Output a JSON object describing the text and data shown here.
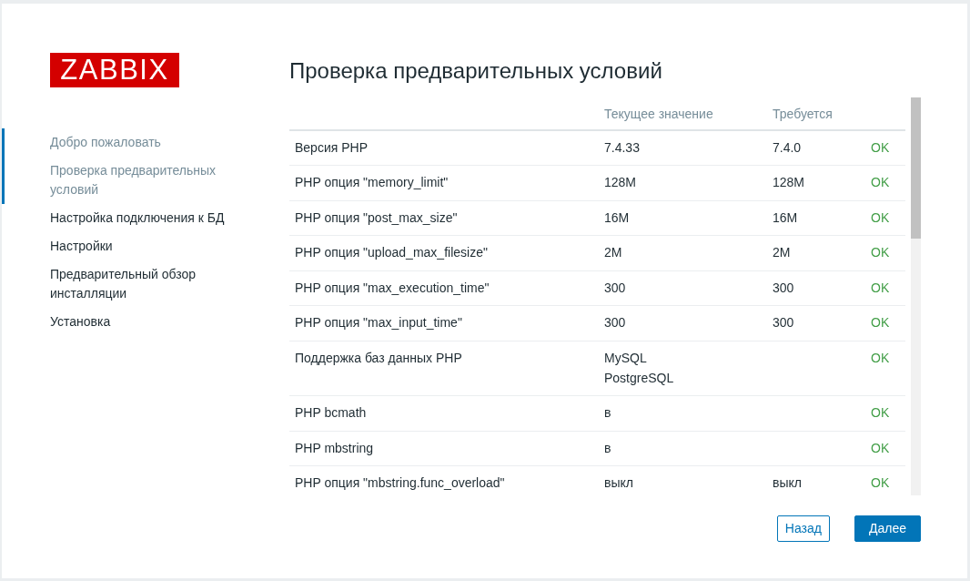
{
  "logo": {
    "text": "ZABBIX"
  },
  "steps": [
    {
      "label": "Добро пожаловать",
      "active": true
    },
    {
      "label": "Проверка предварительных условий",
      "active": true
    },
    {
      "label": "Настройка подключения к БД",
      "active": false
    },
    {
      "label": "Настройки",
      "active": false
    },
    {
      "label": "Предварительный обзор инсталляции",
      "active": false
    },
    {
      "label": "Установка",
      "active": false
    }
  ],
  "title": "Проверка предварительных условий",
  "table": {
    "columns": [
      {
        "label": "Текущее значение"
      },
      {
        "label": "Требуется"
      }
    ],
    "rows": [
      {
        "name": "Версия PHP",
        "current": [
          "7.4.33"
        ],
        "required": "7.4.0",
        "result": "OK",
        "passed": true
      },
      {
        "name": "PHP опция \"memory_limit\"",
        "current": [
          "128M"
        ],
        "required": "128M",
        "result": "OK",
        "passed": true
      },
      {
        "name": "PHP опция \"post_max_size\"",
        "current": [
          "16M"
        ],
        "required": "16M",
        "result": "OK",
        "passed": true
      },
      {
        "name": "PHP опция \"upload_max_filesize\"",
        "current": [
          "2M"
        ],
        "required": "2M",
        "result": "OK",
        "passed": true
      },
      {
        "name": "PHP опция \"max_execution_time\"",
        "current": [
          "300"
        ],
        "required": "300",
        "result": "OK",
        "passed": true
      },
      {
        "name": "PHP опция \"max_input_time\"",
        "current": [
          "300"
        ],
        "required": "300",
        "result": "OK",
        "passed": true
      },
      {
        "name": "Поддержка баз данных PHP",
        "current": [
          "MySQL",
          "PostgreSQL"
        ],
        "result": "OK",
        "passed": true
      },
      {
        "name": "PHP bcmath",
        "current": [
          "в"
        ],
        "result": "OK",
        "passed": true
      },
      {
        "name": "PHP mbstring",
        "current": [
          "в"
        ],
        "result": "OK",
        "passed": true
      },
      {
        "name": "PHP опция \"mbstring.func_overload\"",
        "current": [
          "выкл"
        ],
        "required": "выкл",
        "result": "OK",
        "passed": true
      }
    ]
  },
  "buttons": [
    {
      "label": "Назад",
      "kind": "secondary"
    },
    {
      "label": "Далее",
      "kind": "primary"
    }
  ]
}
